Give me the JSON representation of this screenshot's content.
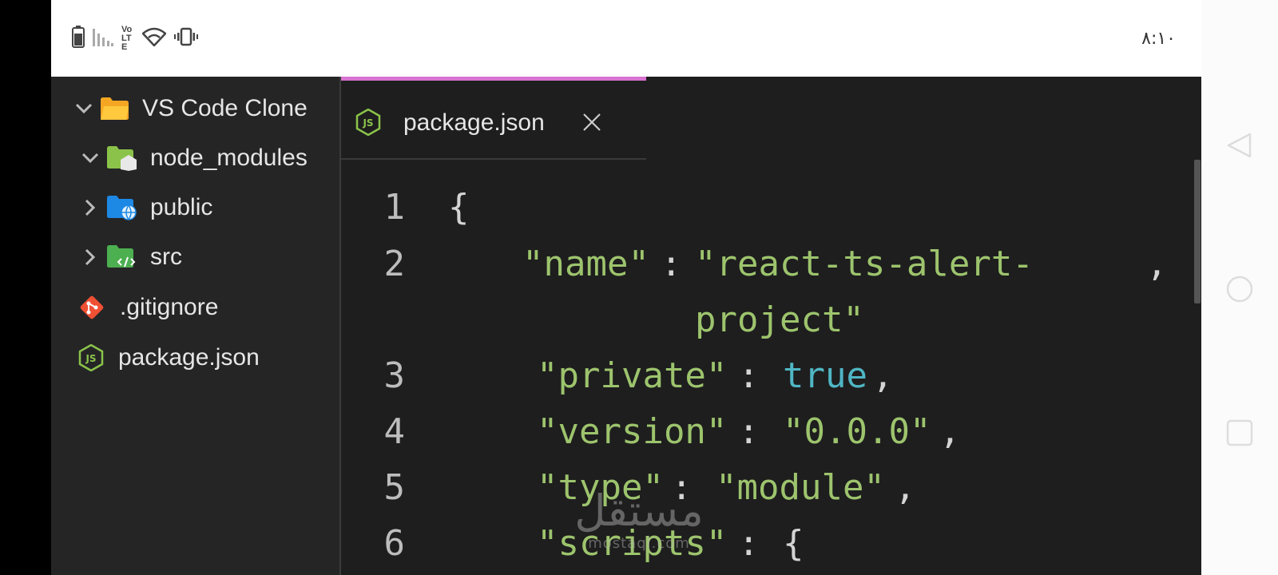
{
  "status_bar": {
    "time": "٨:١٠",
    "icons": [
      "battery-icon",
      "signal-icon",
      "volte-icon",
      "wifi-icon",
      "vibrate-icon"
    ],
    "volte_label": "Vo LTE"
  },
  "explorer": {
    "items": [
      {
        "label": "VS Code Clone",
        "icon": "folder-open-icon",
        "chevron": "down"
      },
      {
        "label": "node_modules",
        "icon": "node-folder-icon",
        "chevron": "down"
      },
      {
        "label": "public",
        "icon": "public-folder-icon",
        "chevron": "right"
      },
      {
        "label": "src",
        "icon": "src-folder-icon",
        "chevron": "right"
      },
      {
        "label": ".gitignore",
        "icon": "git-icon",
        "chevron": ""
      },
      {
        "label": "package.json",
        "icon": "node-js-icon",
        "chevron": ""
      }
    ]
  },
  "editor": {
    "tab": {
      "label": "package.json",
      "icon": "node-js-icon",
      "close": "close-icon"
    },
    "lines": [
      {
        "number": "1",
        "tokens": [
          "{"
        ]
      },
      {
        "number": "2",
        "tokens": [
          "\"name\"",
          ":",
          "\"react-ts-alert-",
          ",",
          "project\""
        ]
      },
      {
        "number": "3",
        "tokens": [
          "\"private\"",
          ":",
          "true",
          ","
        ]
      },
      {
        "number": "4",
        "tokens": [
          "\"version\"",
          ":",
          "\"0.0.0\"",
          ","
        ]
      },
      {
        "number": "5",
        "tokens": [
          "\"type\"",
          ":",
          "\"module\"",
          ","
        ]
      },
      {
        "number": "6",
        "tokens": [
          "\"scripts\"",
          ":",
          "{"
        ]
      }
    ]
  },
  "colors": {
    "tab_accent": "#d772d0",
    "string": "#9dc46d",
    "boolean": "#4fb6c4",
    "sidebar_bg": "#252526",
    "editor_bg": "#1e1e1e"
  },
  "navigation": {
    "buttons": [
      "back-icon",
      "home-icon",
      "recents-icon"
    ]
  },
  "watermark": {
    "arabic": "مستقل",
    "latin": "mostaql.com"
  }
}
